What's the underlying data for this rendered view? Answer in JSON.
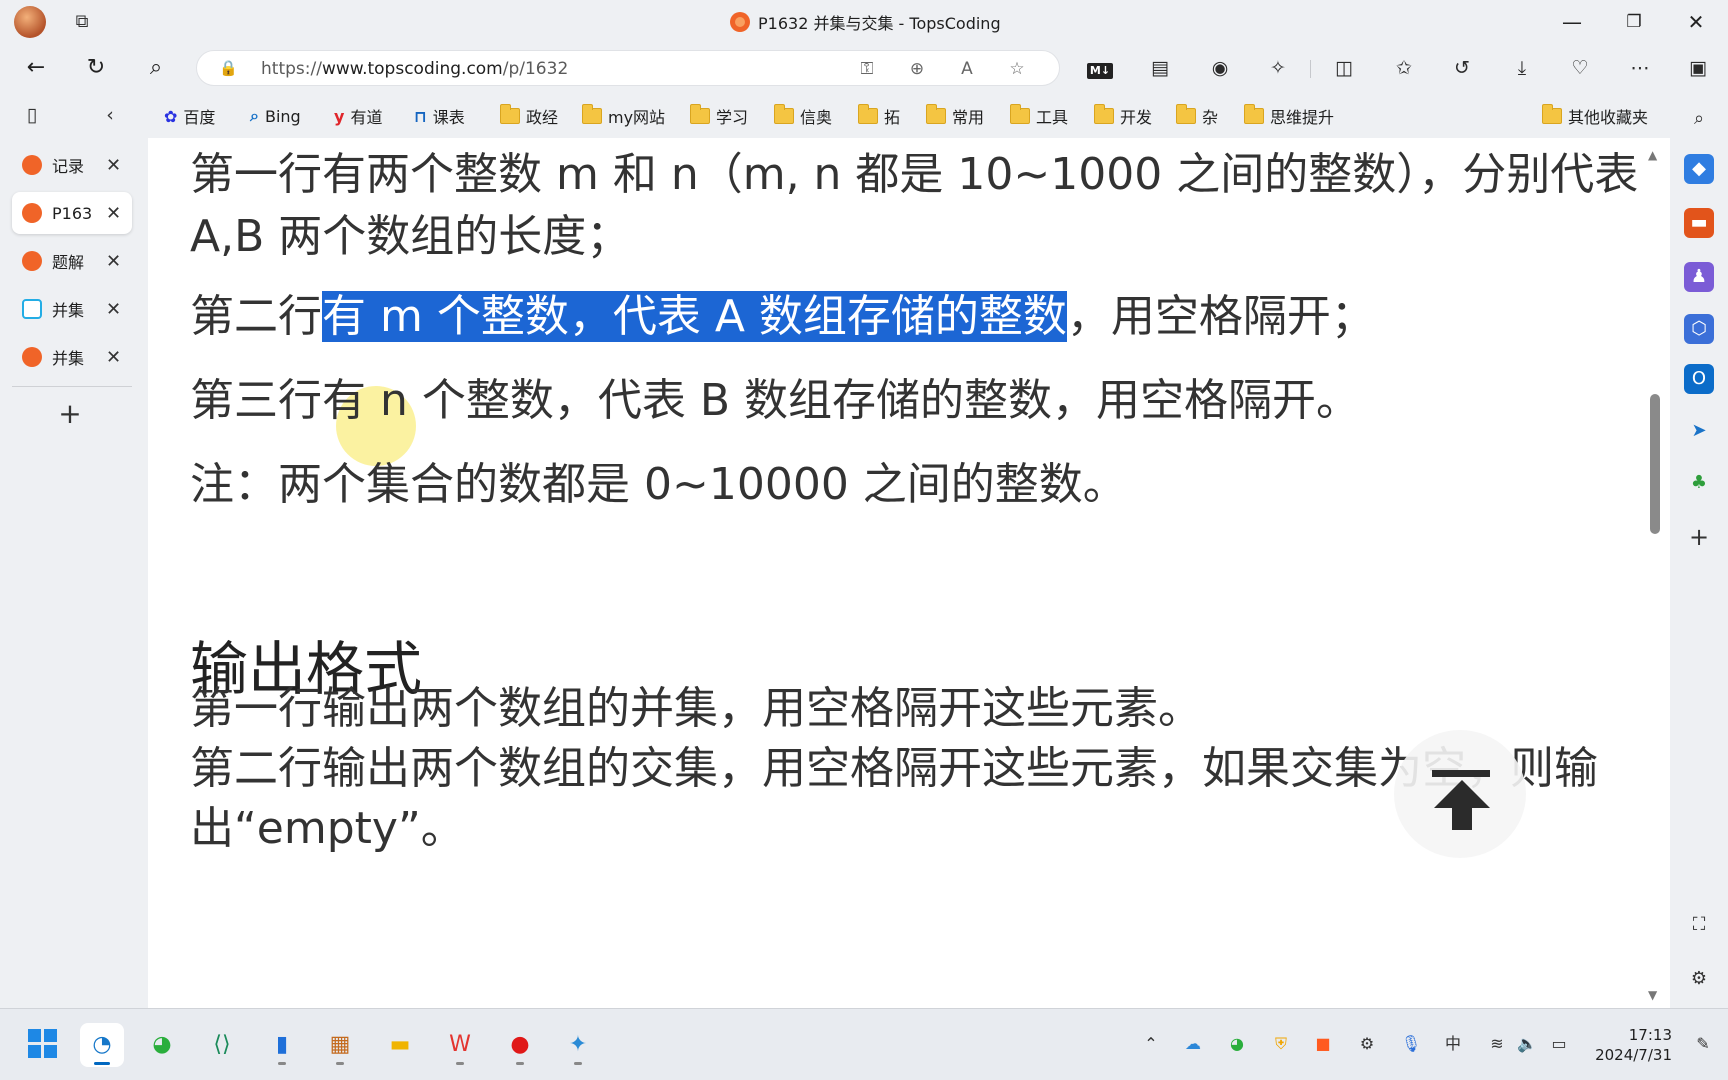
{
  "window": {
    "title": "P1632 并集与交集 - TopsCoding",
    "minimize": "—",
    "restore": "❐",
    "close": "✕"
  },
  "nav": {
    "back": "←",
    "refresh": "↻",
    "search": "⌕",
    "url_prefix": "https://",
    "url_host": "www.topscoding.com",
    "url_path": "/p/1632",
    "md_badge": "M↓"
  },
  "bookmarks": [
    {
      "label": "百度",
      "icon": "baidu-icon"
    },
    {
      "label": "Bing",
      "icon": "bing-icon"
    },
    {
      "label": "有道",
      "icon": "youdao-icon"
    },
    {
      "label": "课表",
      "icon": "kebiao-icon"
    },
    {
      "label": "政经",
      "icon": "folder-icon"
    },
    {
      "label": "my网站",
      "icon": "folder-icon"
    },
    {
      "label": "学习",
      "icon": "folder-icon"
    },
    {
      "label": "信奥",
      "icon": "folder-icon"
    },
    {
      "label": "拓",
      "icon": "folder-icon"
    },
    {
      "label": "常用",
      "icon": "folder-icon"
    },
    {
      "label": "工具",
      "icon": "folder-icon"
    },
    {
      "label": "开发",
      "icon": "folder-icon"
    },
    {
      "label": "杂",
      "icon": "folder-icon"
    },
    {
      "label": "思维提升",
      "icon": "folder-icon"
    },
    {
      "label": "其他收藏夹",
      "icon": "folder-icon"
    }
  ],
  "tabs": [
    {
      "label": "记录",
      "active": false
    },
    {
      "label": "P163",
      "active": true
    },
    {
      "label": "题解",
      "active": false
    },
    {
      "label": "并集",
      "active": false
    },
    {
      "label": "并集",
      "active": false
    }
  ],
  "content": {
    "line1": "第一行有两个整数 m 和 n（m, n 都是 10~1000 之间的整数），分别代表",
    "line1b": "A,B 两个数组的长度；",
    "line2_pre": "第二行",
    "line2_sel": "有 m 个整数，代表 A 数组存储的整数",
    "line2_post": "，用空格隔开；",
    "line3": "第三行有 n 个整数，代表 B 数组存储的整数，用空格隔开。",
    "line4": "注：两个集合的数都是 0~10000 之间的整数。",
    "heading": "输出格式",
    "out1": "第一行输出两个数组的并集，用空格隔开这些元素。",
    "out2": "第二行输出两个数组的交集，用空格隔开这些元素，如果交集为空，则输",
    "out3": "出“empty”。"
  },
  "taskbar": {
    "time": "17:13",
    "date": "2024/7/31",
    "ime": "中"
  },
  "colors": {
    "selection": "#1c66d4",
    "accent": "#0067c0",
    "brand": "#f06428"
  }
}
